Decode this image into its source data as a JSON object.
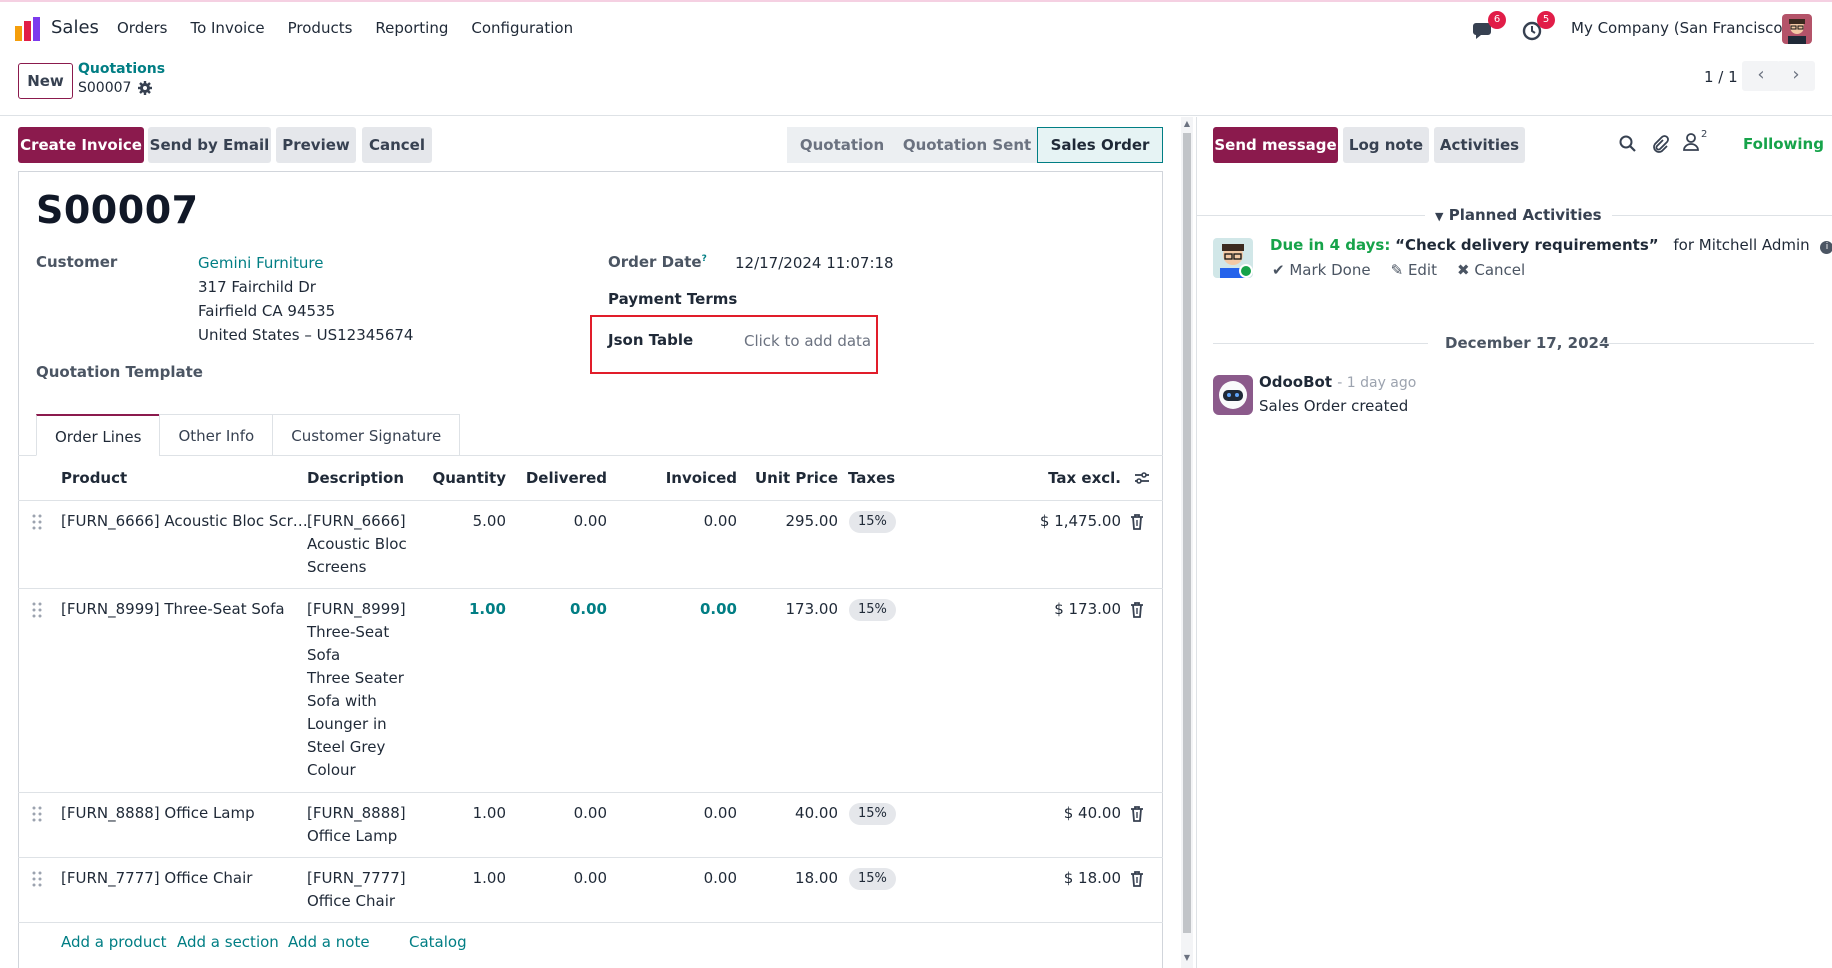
{
  "app": {
    "name": "Sales",
    "menu": [
      "Orders",
      "To Invoice",
      "Products",
      "Reporting",
      "Configuration"
    ],
    "messages_badge": "6",
    "activities_badge": "5",
    "company": "My Company (San Francisco)"
  },
  "control": {
    "new_label": "New",
    "breadcrumb_parent": "Quotations",
    "breadcrumb_current": "S00007",
    "pager": "1 / 1"
  },
  "actions": {
    "create_invoice": "Create Invoice",
    "send_email": "Send by Email",
    "preview": "Preview",
    "cancel": "Cancel"
  },
  "status": {
    "stages": [
      "Quotation",
      "Quotation Sent",
      "Sales Order"
    ],
    "active": "Sales Order"
  },
  "form": {
    "name": "S00007",
    "customer_label": "Customer",
    "customer_name": "Gemini Furniture",
    "address_1": "317 Fairchild Dr",
    "address_2": "Fairfield CA 94535",
    "address_3": "United States – US12345674",
    "template_label": "Quotation Template",
    "order_date_label": "Order Date",
    "order_date_help": "?",
    "order_date": "12/17/2024 11:07:18",
    "payment_terms_label": "Payment Terms",
    "json_table_label": "Json Table",
    "json_table_placeholder": "Click to add data"
  },
  "tabs": [
    "Order Lines",
    "Other Info",
    "Customer Signature"
  ],
  "table": {
    "headers": {
      "product": "Product",
      "description": "Description",
      "quantity": "Quantity",
      "delivered": "Delivered",
      "invoiced": "Invoiced",
      "unit_price": "Unit Price",
      "taxes": "Taxes",
      "subtotal": "Tax excl."
    },
    "rows": [
      {
        "product": "[FURN_6666] Acoustic Bloc Scr…",
        "description": [
          "[FURN_6666]",
          "Acoustic Bloc",
          "Screens"
        ],
        "quantity": "5.00",
        "delivered": "0.00",
        "invoiced": "0.00",
        "unit_price": "295.00",
        "tax": "15%",
        "subtotal": "$ 1,475.00"
      },
      {
        "product": "[FURN_8999] Three-Seat Sofa",
        "description": [
          "[FURN_8999]",
          "Three-Seat",
          "Sofa",
          "Three Seater",
          "Sofa with",
          "Lounger in",
          "Steel Grey",
          "Colour"
        ],
        "quantity": "1.00",
        "delivered": "0.00",
        "invoiced": "0.00",
        "unit_price": "173.00",
        "tax": "15%",
        "subtotal": "$ 173.00"
      },
      {
        "product": "[FURN_8888] Office Lamp",
        "description": [
          "[FURN_8888]",
          "Office Lamp"
        ],
        "quantity": "1.00",
        "delivered": "0.00",
        "invoiced": "0.00",
        "unit_price": "40.00",
        "tax": "15%",
        "subtotal": "$ 40.00"
      },
      {
        "product": "[FURN_7777] Office Chair",
        "description": [
          "[FURN_7777]",
          "Office Chair"
        ],
        "quantity": "1.00",
        "delivered": "0.00",
        "invoiced": "0.00",
        "unit_price": "18.00",
        "tax": "15%",
        "subtotal": "$ 18.00"
      }
    ],
    "add_links": [
      "Add a product",
      "Add a section",
      "Add a note",
      "Catalog"
    ]
  },
  "chatter": {
    "send_message": "Send message",
    "log_note": "Log note",
    "activities": "Activities",
    "followers_count": "2",
    "following": "Following",
    "planned_title": "Planned Activities",
    "due_label": "Due in 4 days:",
    "activity_summary": "“Check delivery requirements”",
    "activity_for": "for Mitchell Admin",
    "mark_done": "Mark Done",
    "edit": "Edit",
    "cancel": "Cancel",
    "date_separator": "December 17, 2024",
    "message_author": "OdooBot",
    "message_time": "- 1 day ago",
    "message_body": "Sales Order created"
  },
  "colors": {
    "brand": "#8b1a4d",
    "link": "#017e84",
    "following": "#16a34a",
    "badge": "#e11d48",
    "highlight_box": "#e11d2a"
  },
  "icons": [
    "sales-app-icon",
    "chat-icon",
    "clock-icon",
    "gear-icon",
    "chevron-left-icon",
    "chevron-right-icon",
    "search-icon",
    "paperclip-icon",
    "followers-icon",
    "drag-handle-icon",
    "trash-icon",
    "column-settings-icon",
    "caret-down-icon",
    "check-icon",
    "pencil-icon",
    "close-icon",
    "info-icon"
  ]
}
